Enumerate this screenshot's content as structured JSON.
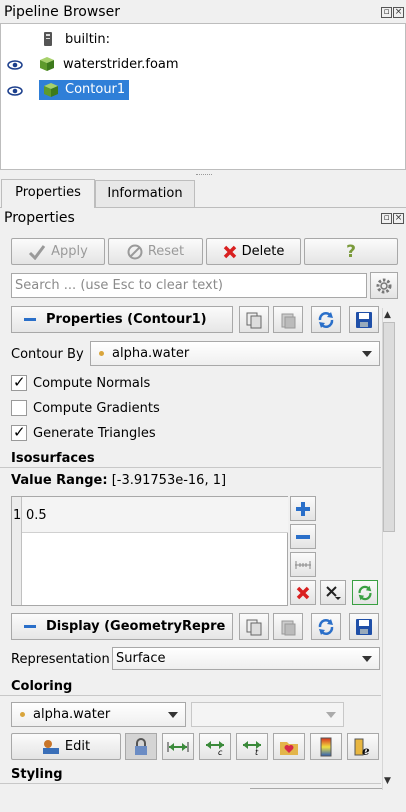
{
  "pipeline": {
    "title": "Pipeline Browser",
    "items": [
      {
        "label": "builtin:"
      },
      {
        "label": "waterstrider.foam"
      },
      {
        "label": "Contour1"
      }
    ]
  },
  "tabs": [
    "Properties",
    "Information"
  ],
  "properties": {
    "title": "Properties",
    "apply": "Apply",
    "reset": "Reset",
    "delete": "Delete",
    "help": "?",
    "search_placeholder": "Search ... (use Esc to clear text)",
    "section_properties": "Properties (Contour1)",
    "contour_by_label": "Contour By",
    "contour_by_value": "alpha.water",
    "compute_normals": {
      "label": "Compute Normals",
      "checked": true
    },
    "compute_gradients": {
      "label": "Compute Gradients",
      "checked": false
    },
    "generate_triangles": {
      "label": "Generate Triangles",
      "checked": true
    },
    "isosurfaces_header": "Isosurfaces",
    "value_range_label": "Value Range:",
    "value_range": "[-3.91753e-16, 1]",
    "iso_rows": [
      {
        "index": "1",
        "value": "0.5"
      }
    ],
    "section_display": "Display (GeometryRepre",
    "representation_label": "Representation",
    "representation_value": "Surface",
    "coloring_header": "Coloring",
    "coloring_value": "alpha.water",
    "edit": "Edit",
    "styling_header": "Styling"
  },
  "colors": {
    "selection": "#2f7fd8",
    "accent_blue": "#2a6fc9",
    "delete_red": "#d92020",
    "refresh_green": "#3aa043"
  }
}
